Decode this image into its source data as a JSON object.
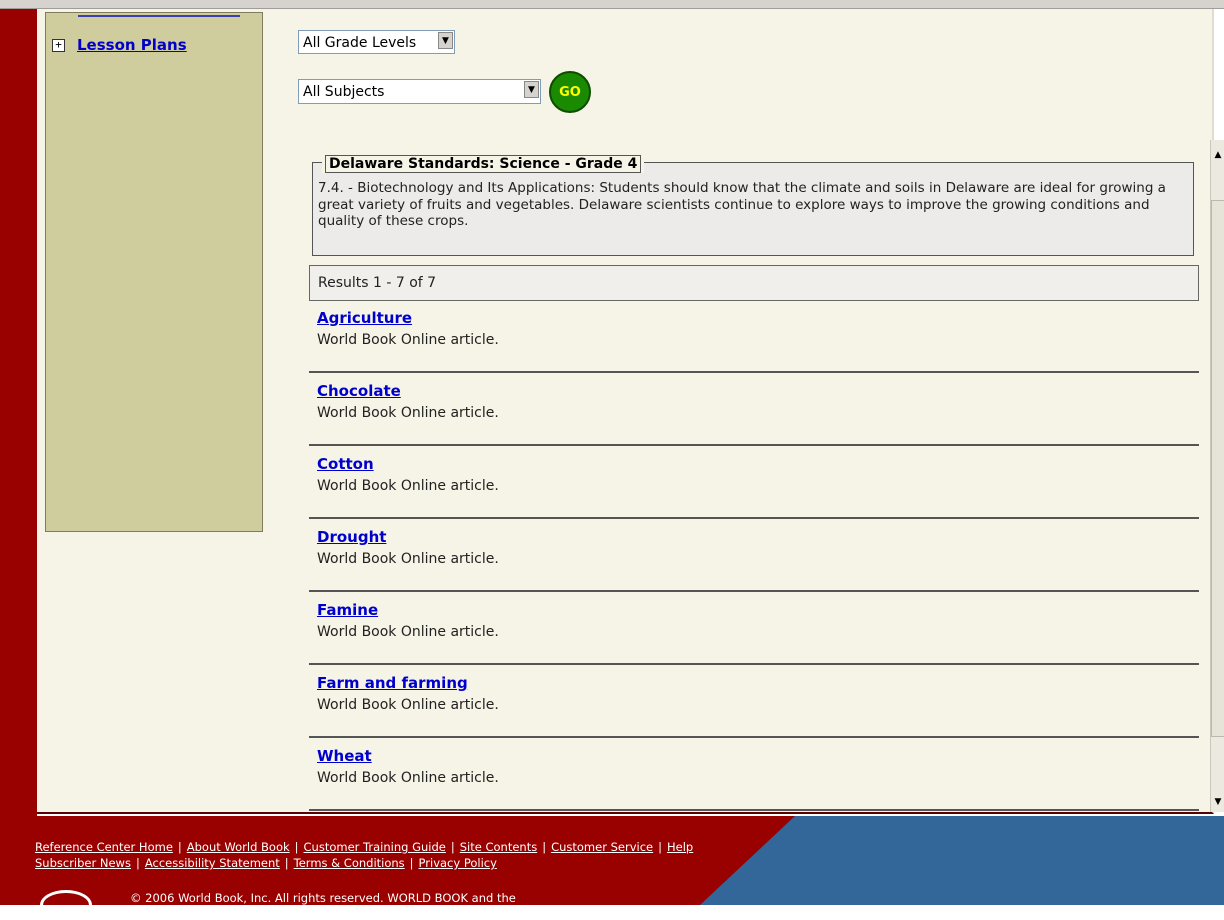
{
  "sidebar": {
    "lesson_plans_label": "Lesson Plans",
    "expand_symbol": "+"
  },
  "filters": {
    "grade_level": "All Grade Levels",
    "subject": "All Subjects",
    "go_label": "GO"
  },
  "standard": {
    "title": "Delaware Standards: Science - Grade 4",
    "text": "7.4. - Biotechnology and Its Applications: Students should know that the climate and soils in Delaware are ideal for growing a great variety of fruits and vegetables. Delaware scientists continue to explore ways to improve the growing conditions and quality of these crops."
  },
  "results": {
    "summary": "Results 1 - 7 of 7",
    "items": [
      {
        "title": "Agriculture",
        "desc": "World Book Online article."
      },
      {
        "title": "Chocolate",
        "desc": "World Book Online article."
      },
      {
        "title": "Cotton",
        "desc": "World Book Online article."
      },
      {
        "title": "Drought",
        "desc": "World Book Online article."
      },
      {
        "title": "Famine",
        "desc": "World Book Online article."
      },
      {
        "title": "Farm and farming",
        "desc": "World Book Online article."
      },
      {
        "title": "Wheat",
        "desc": "World Book Online article."
      }
    ]
  },
  "footer": {
    "links_row1": [
      "Reference Center Home",
      "About World Book",
      "Customer Training Guide",
      "Site Contents",
      "Customer Service",
      "Help"
    ],
    "links_row2": [
      "Subscriber News",
      "Accessibility Statement",
      "Terms & Conditions",
      "Privacy Policy"
    ],
    "separator": "|",
    "copyright": "© 2006 World Book, Inc. All rights reserved. WORLD BOOK and the"
  },
  "colors": {
    "frame_red": "#990000",
    "footer_blue": "#336699",
    "link_blue": "#0000cc",
    "sidebar_olive": "#cfcc9e",
    "content_bg": "#f6f3e7",
    "go_green": "#1a8a00"
  },
  "icons": {
    "go": "go-button-icon",
    "dropdown": "chevron-down-icon",
    "expand": "plus-box-icon",
    "scroll_up": "arrow-up-icon",
    "scroll_down": "arrow-down-icon"
  }
}
